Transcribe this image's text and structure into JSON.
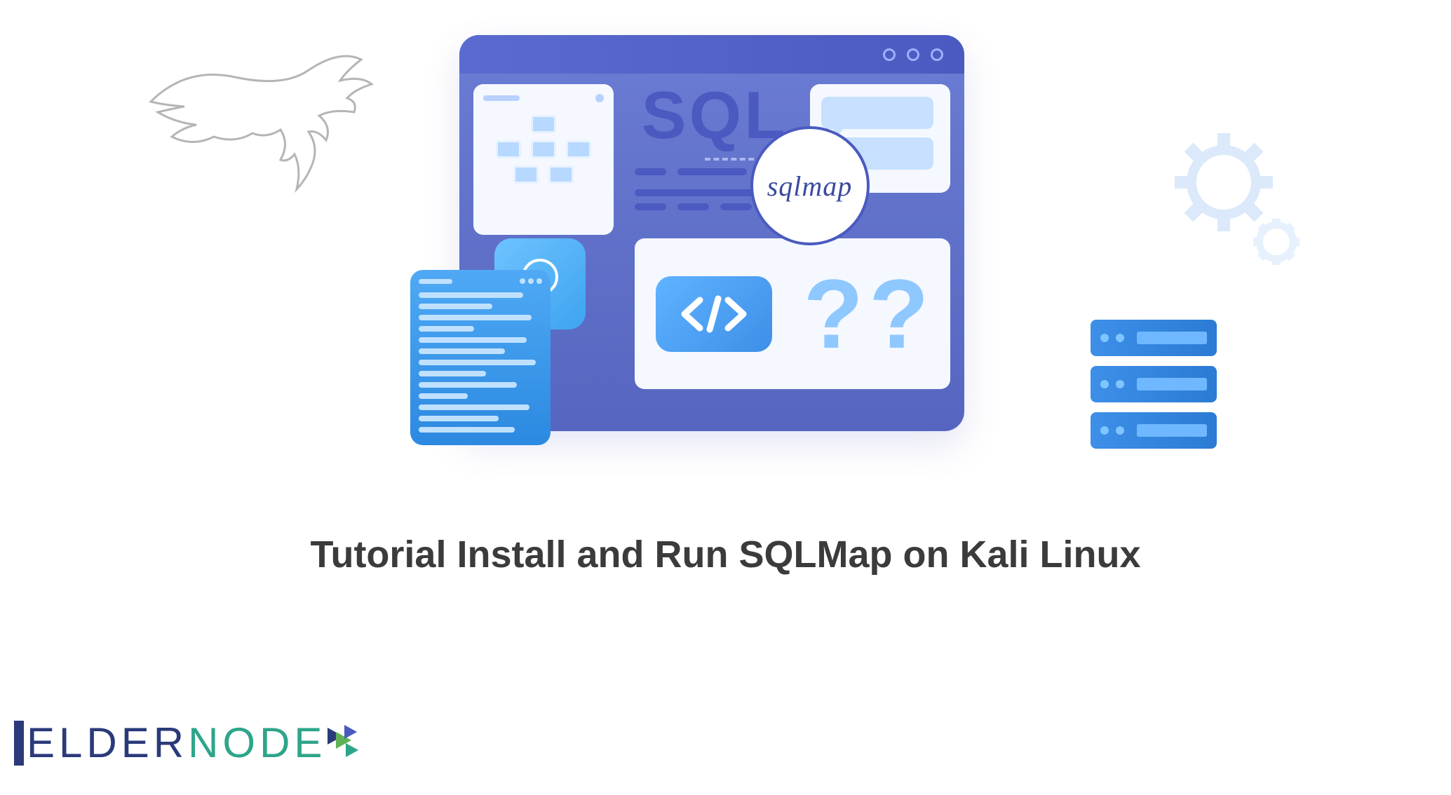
{
  "illustration": {
    "sql_label": "SQL",
    "sqlmap_label": "sqlmap",
    "question_mark": "?"
  },
  "title": "Tutorial Install and Run SQLMap on Kali Linux",
  "logo": {
    "brand_part1": "ELDER",
    "brand_part2": "NODE"
  },
  "icons": {
    "dragon": "kali-dragon",
    "gear": "gear-icon",
    "bulb": "lightbulb-icon",
    "code": "code-tag-icon",
    "server": "server-icon"
  },
  "colors": {
    "primary": "#4a5ac0",
    "accent_blue": "#3d8fe8",
    "light_blue": "#b8d9ff",
    "text": "#3b3b3b",
    "logo_navy": "#2a3a7a",
    "logo_green": "#2ea58a"
  }
}
